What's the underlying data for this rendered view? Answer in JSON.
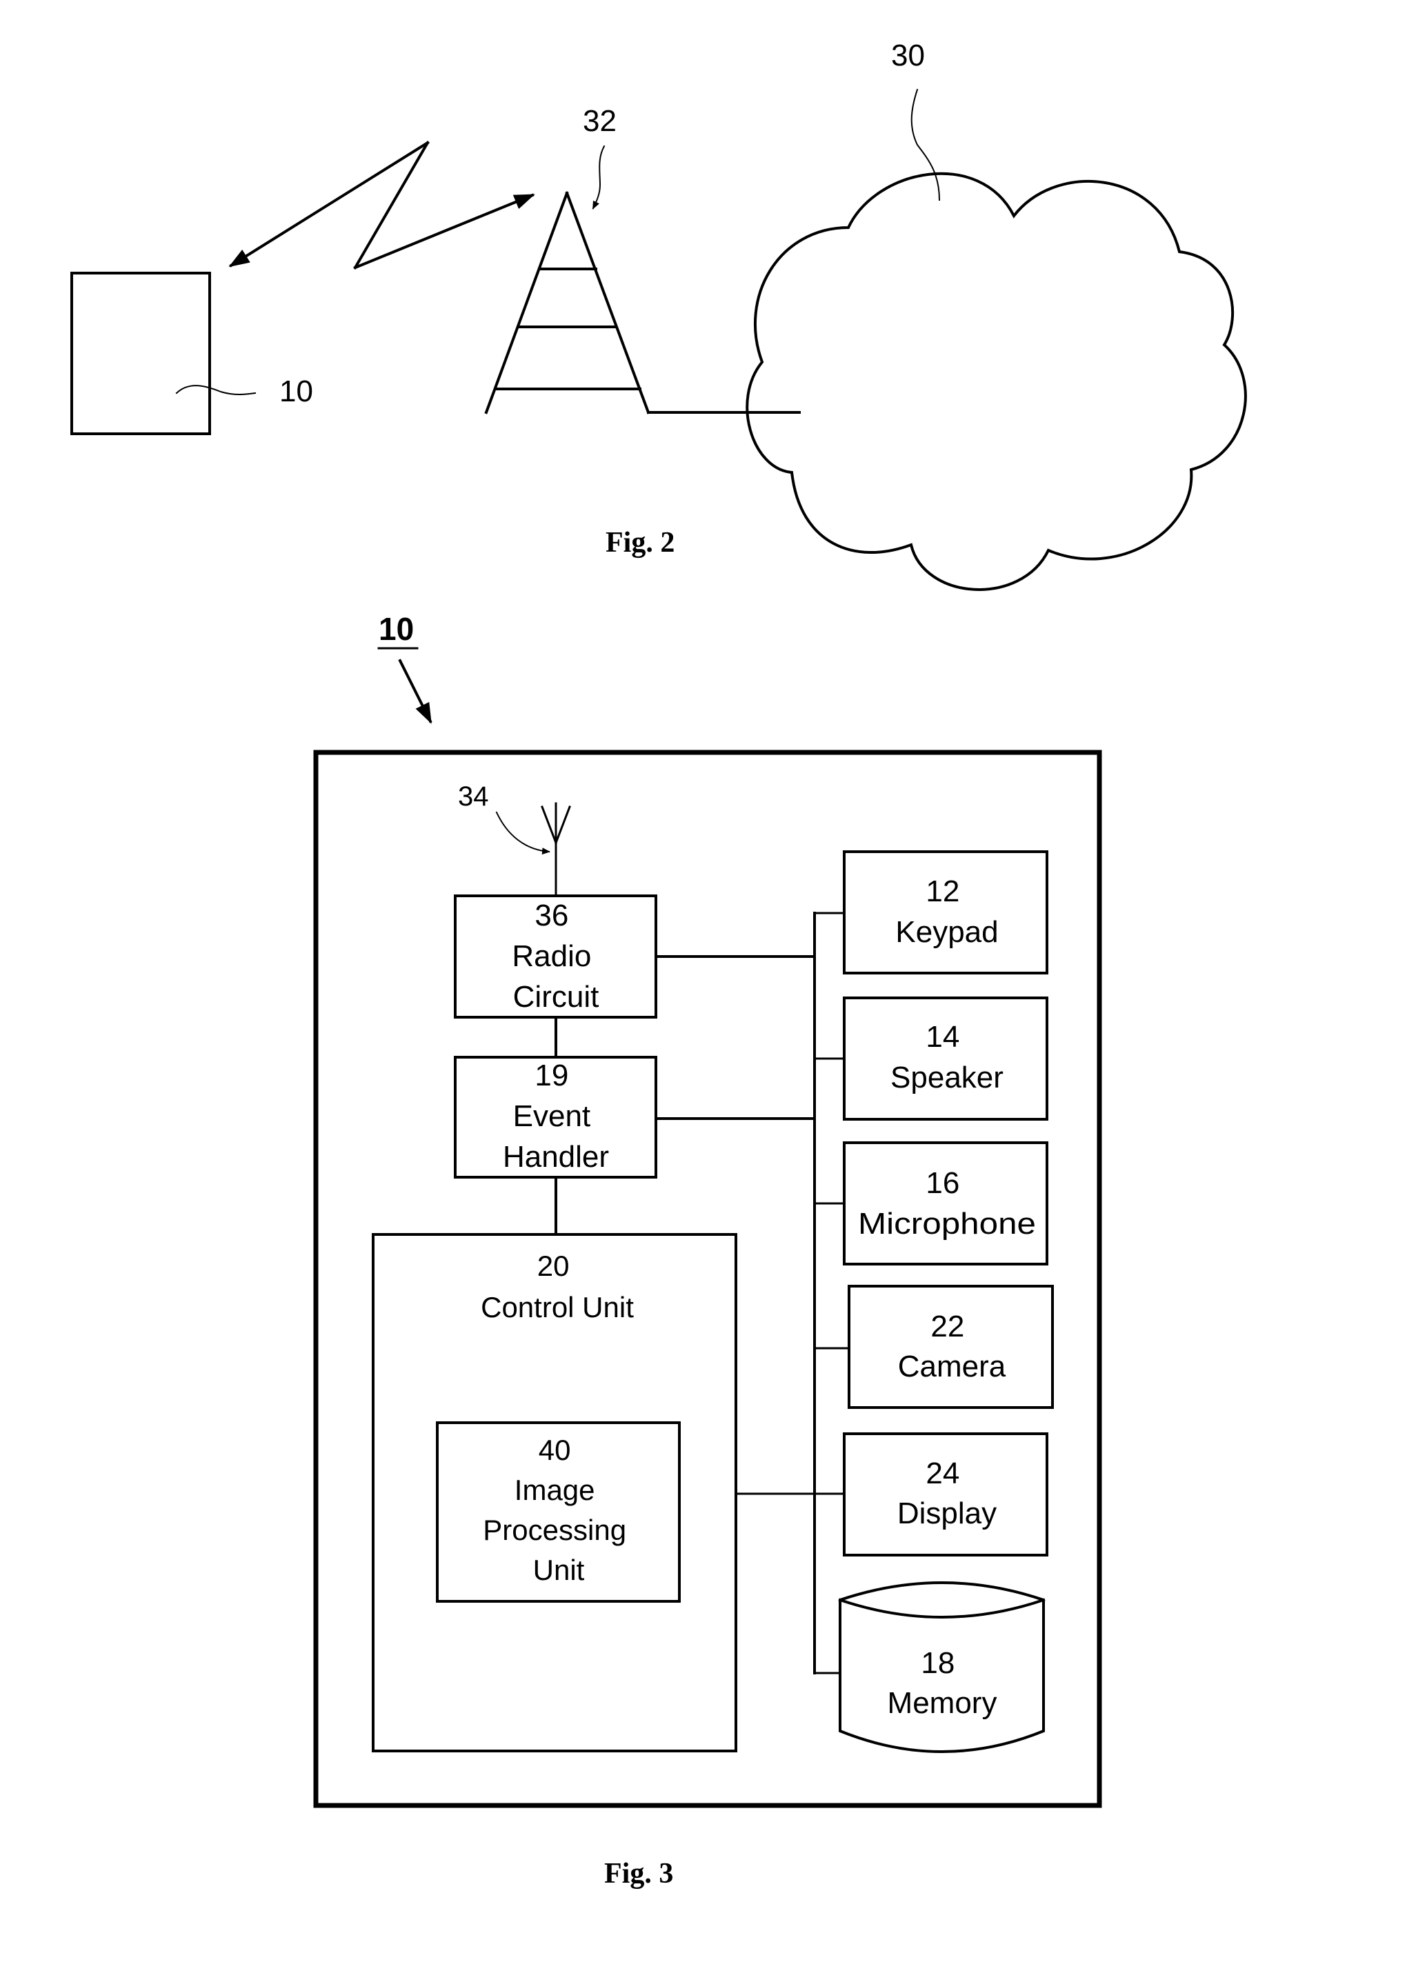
{
  "figure2": {
    "caption": "Fig. 2",
    "device_ref": "10",
    "tower_ref": "32",
    "network_ref": "30"
  },
  "figure3": {
    "caption": "Fig. 3",
    "device_ref": "10",
    "antenna_ref": "34",
    "blocks": {
      "radio": {
        "ref": "36",
        "lines": [
          "Radio",
          "Circuit"
        ]
      },
      "event": {
        "ref": "19",
        "lines": [
          "Event",
          "Handler"
        ]
      },
      "control": {
        "ref": "20",
        "lines": [
          "Control Unit"
        ]
      },
      "ipu": {
        "ref": "40",
        "lines": [
          "Image",
          "Processing",
          "Unit"
        ]
      },
      "keypad": {
        "ref": "12",
        "lines": [
          "Keypad"
        ]
      },
      "speaker": {
        "ref": "14",
        "lines": [
          "Speaker"
        ]
      },
      "microphone": {
        "ref": "16",
        "lines": [
          "Microphone"
        ]
      },
      "camera": {
        "ref": "22",
        "lines": [
          "Camera"
        ]
      },
      "display": {
        "ref": "24",
        "lines": [
          "Display"
        ]
      },
      "memory": {
        "ref": "18",
        "lines": [
          "Memory"
        ]
      }
    }
  }
}
